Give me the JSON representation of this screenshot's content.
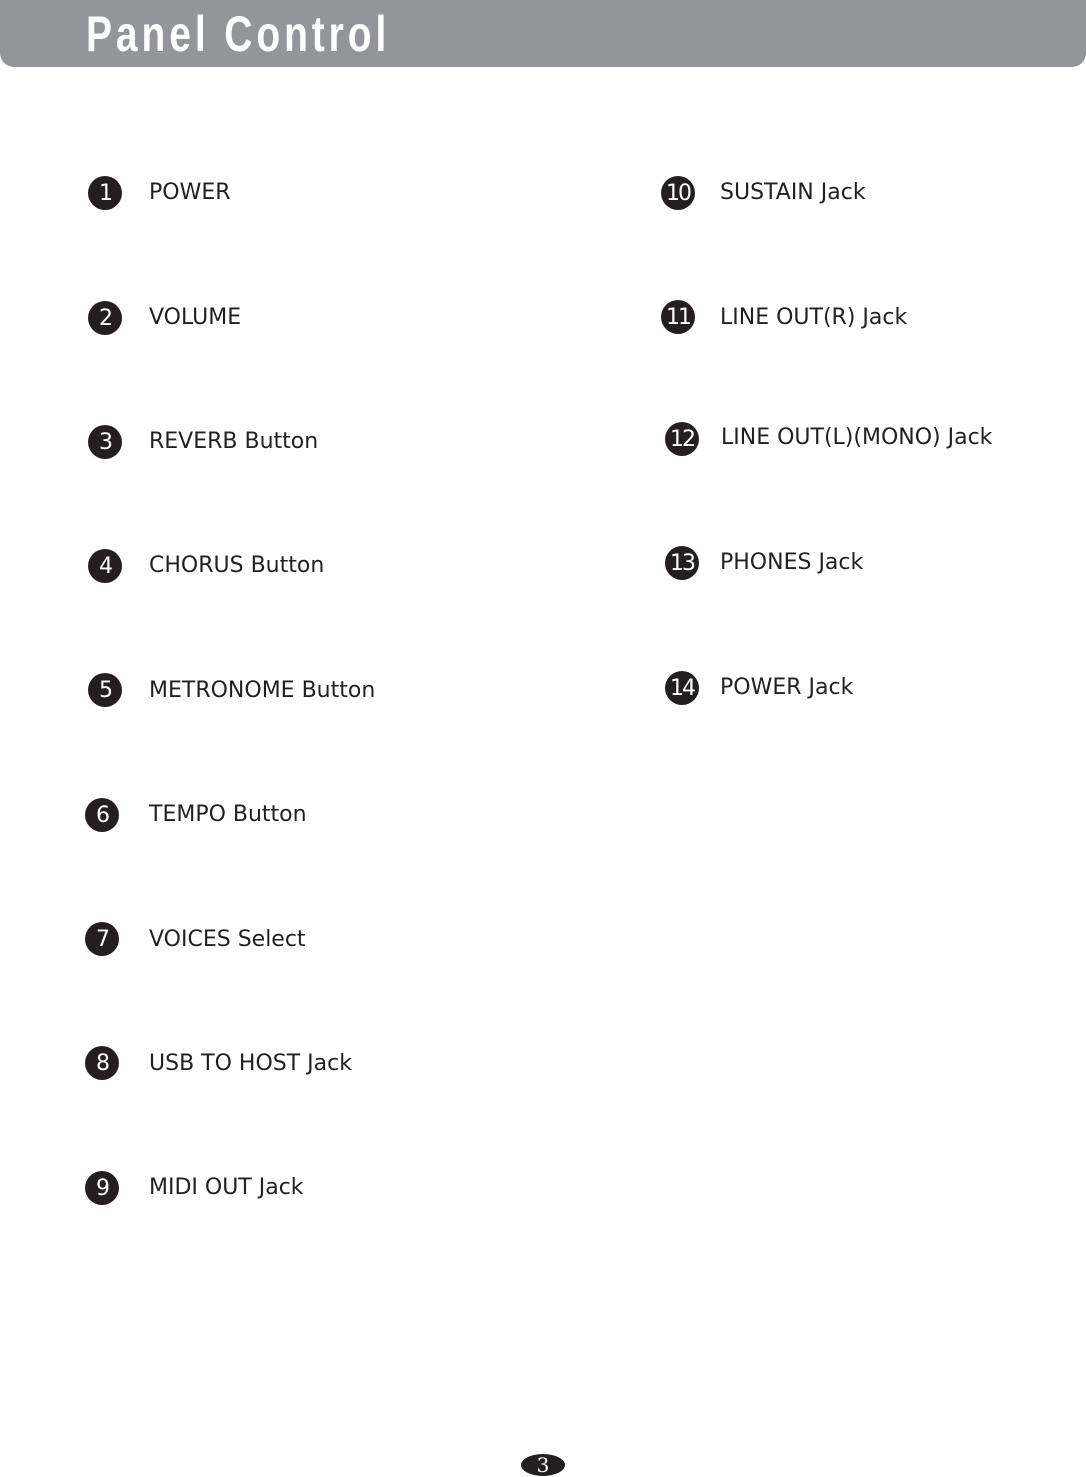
{
  "header": {
    "title": "Panel Control",
    "bar_color": "#939598"
  },
  "left_items": [
    {
      "number": "1",
      "label": "POWER"
    },
    {
      "number": "2",
      "label": "VOLUME"
    },
    {
      "number": "3",
      "label": "REVERB Button"
    },
    {
      "number": "4",
      "label": "CHORUS Button"
    },
    {
      "number": "5",
      "label": "METRONOME Button"
    },
    {
      "number": "6",
      "label": "TEMPO Button"
    },
    {
      "number": "7",
      "label": "VOICES Select"
    },
    {
      "number": "8",
      "label": "USB TO HOST Jack"
    },
    {
      "number": "9",
      "label": "MIDI OUT Jack"
    }
  ],
  "right_items": [
    {
      "number": "10",
      "label": "SUSTAIN Jack"
    },
    {
      "number": "11",
      "label": "LINE OUT(R) Jack"
    },
    {
      "number": "12",
      "label": "LINE OUT(L)(MONO) Jack"
    },
    {
      "number": "13",
      "label": "PHONES Jack"
    },
    {
      "number": "14",
      "label": "POWER Jack"
    }
  ],
  "footer": {
    "page_number": "3"
  }
}
